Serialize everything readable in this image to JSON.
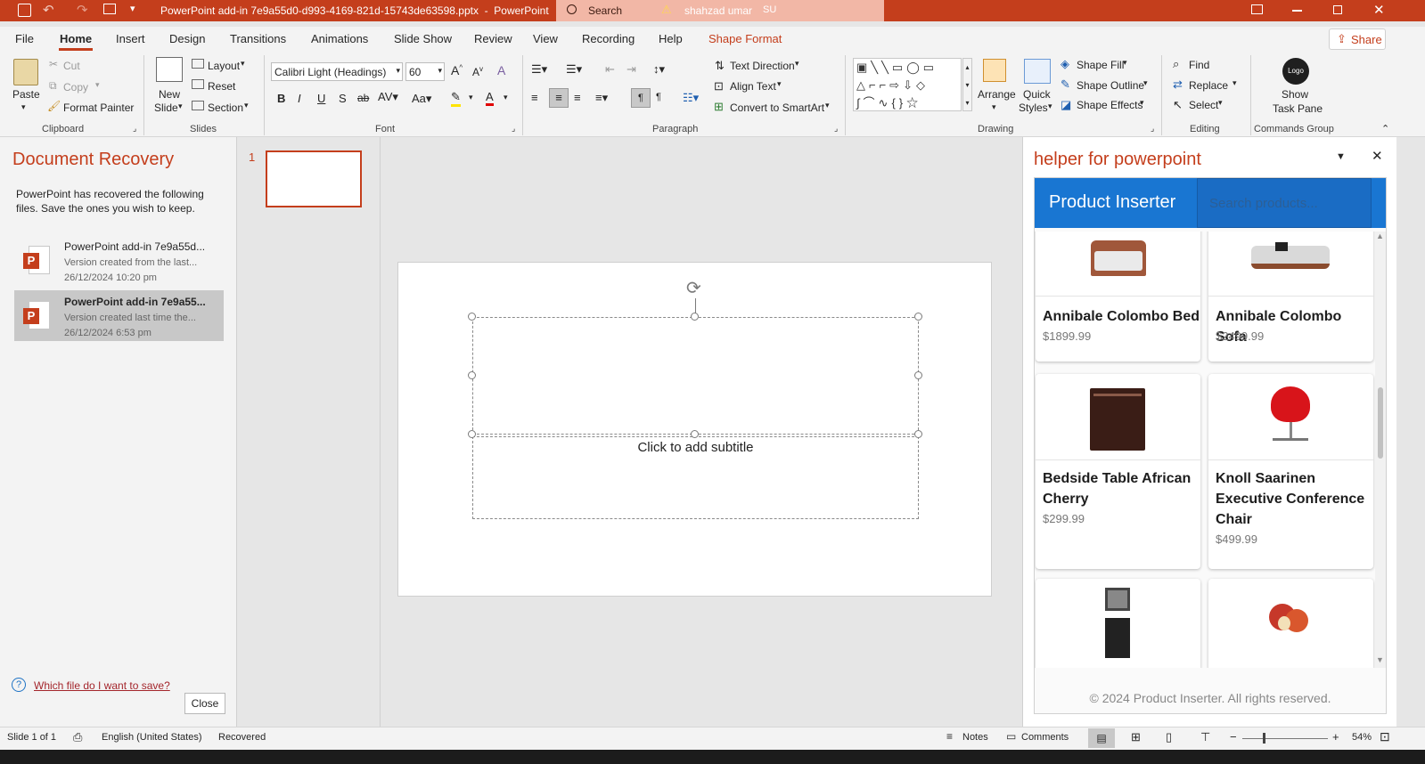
{
  "titlebar": {
    "doc_title": "PowerPoint add-in 7e9a55d0-d993-4169-821d-15743de63598.pptx  -  PowerPoint",
    "search_placeholder": "Search",
    "user_name": "shahzad umar",
    "user_initials": "SU"
  },
  "tabs": [
    "File",
    "Home",
    "Insert",
    "Design",
    "Transitions",
    "Animations",
    "Slide Show",
    "Review",
    "View",
    "Recording",
    "Help",
    "Shape Format"
  ],
  "share_label": "Share",
  "ribbon": {
    "clipboard": {
      "paste": "Paste",
      "cut": "Cut",
      "copy": "Copy",
      "format_painter": "Format Painter",
      "group": "Clipboard"
    },
    "slides": {
      "new_slide_1": "New",
      "new_slide_2": "Slide",
      "layout": "Layout",
      "reset": "Reset",
      "section": "Section",
      "group": "Slides"
    },
    "font": {
      "font_name": "Calibri Light (Headings)",
      "font_size": "60",
      "group": "Font"
    },
    "paragraph": {
      "text_direction": "Text Direction",
      "align_text": "Align Text",
      "smartart": "Convert to SmartArt",
      "group": "Paragraph"
    },
    "drawing": {
      "arrange": "Arrange",
      "quick_styles_1": "Quick",
      "quick_styles_2": "Styles",
      "shape_fill": "Shape Fill",
      "shape_outline": "Shape Outline",
      "shape_effects": "Shape Effects",
      "group": "Drawing"
    },
    "editing": {
      "find": "Find",
      "replace": "Replace",
      "select": "Select",
      "group": "Editing"
    },
    "commands": {
      "logo": "Logo",
      "show_1": "Show",
      "show_2": "Task Pane",
      "group": "Commands Group"
    }
  },
  "recovery": {
    "title": "Document Recovery",
    "description_1": "PowerPoint has recovered the following",
    "description_2": "files.  Save the ones you wish to keep.",
    "items": [
      {
        "name": "PowerPoint add-in 7e9a55d...",
        "desc": "Version created from the last...",
        "date": "26/12/2024 10:20 pm"
      },
      {
        "name": "PowerPoint add-in 7e9a55...",
        "desc": "Version created last time the...",
        "date": "26/12/2024 6:53 pm"
      }
    ],
    "help_link": "Which file do I want to save?",
    "close_label": "Close"
  },
  "thumbs": {
    "slide_number": "1"
  },
  "slide": {
    "subtitle_placeholder": "Click to add subtitle"
  },
  "taskpane": {
    "title": "helper for powerpoint",
    "app_title": "Product Inserter",
    "search_placeholder": "Search products...",
    "products": [
      {
        "name": "Annibale Colombo Bed",
        "price": "$1899.99"
      },
      {
        "name": "Annibale Colombo Sofa",
        "price": "$2499.99"
      },
      {
        "name": "Bedside Table African Cherry",
        "price": "$299.99"
      },
      {
        "name": "Knoll Saarinen Executive Conference Chair",
        "price": "$499.99"
      }
    ],
    "footer": "© 2024 Product Inserter. All rights reserved."
  },
  "status": {
    "slide_info": "Slide 1 of 1",
    "language": "English (United States)",
    "recovered": "Recovered",
    "notes": "Notes",
    "comments": "Comments",
    "zoom": "54%"
  },
  "colors": {
    "accent": "#c43e1c",
    "pane_blue": "#1976d2"
  }
}
